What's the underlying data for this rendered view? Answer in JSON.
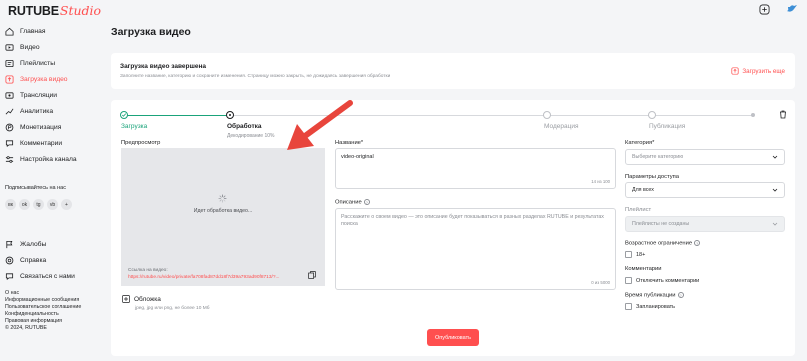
{
  "app": {
    "brand": "RUTUBE",
    "brand_suffix": "Studio",
    "accent": "#ff4f4f"
  },
  "sidebar": {
    "items": [
      {
        "label": "Главная",
        "icon": "home-icon"
      },
      {
        "label": "Видео",
        "icon": "video-icon"
      },
      {
        "label": "Плейлисты",
        "icon": "playlist-icon"
      },
      {
        "label": "Загрузка видео",
        "icon": "upload-icon",
        "active": true
      },
      {
        "label": "Трансляции",
        "icon": "broadcast-icon"
      },
      {
        "label": "Аналитика",
        "icon": "analytics-icon"
      },
      {
        "label": "Монетизация",
        "icon": "monetization-icon"
      },
      {
        "label": "Комментарии",
        "icon": "comments-icon"
      },
      {
        "label": "Настройка канала",
        "icon": "settings-icon"
      }
    ],
    "subscribe_label": "Подписывайтесь на нас",
    "socials": [
      "вк",
      "ok",
      "tg",
      "vb",
      "+"
    ],
    "bottom_items": [
      {
        "label": "Жалобы",
        "icon": "flag-icon"
      },
      {
        "label": "Справка",
        "icon": "help-icon"
      },
      {
        "label": "Связаться с нами",
        "icon": "contact-icon"
      }
    ],
    "footer_links": [
      "О нас",
      "Информационные сообщения",
      "Пользовательское соглашение",
      "Конфиденциальность",
      "Правовая информация",
      "© 2024, RUTUBE"
    ]
  },
  "header": {
    "title": "Загрузка видео"
  },
  "banner": {
    "title": "Загрузка видео завершена",
    "description": "Заполните название, категорию и сохраните изменения. Страницу можно закрыть, не дожидаясь завершения обработки",
    "upload_more": "Загрузить еще"
  },
  "steps": [
    {
      "label": "Загрузка",
      "state": "done"
    },
    {
      "label": "Обработка",
      "sub": "Декодирование 10%",
      "state": "active"
    },
    {
      "label": "Модерация",
      "state": "pending"
    },
    {
      "label": "Публикация",
      "state": "pending"
    }
  ],
  "preview": {
    "label": "Предпросмотр",
    "processing": "Идет обработка видео...",
    "link_label": "Ссылка на видео:",
    "link": "https://rutube.ru/video/private/fa708fad87dd18f7d39a793ad90f8713/?..."
  },
  "cover": {
    "label": "Обложка",
    "hint": "jpeg, jpg или png, не более 10 Мб"
  },
  "form": {
    "name_label": "Название*",
    "name_value": "video-original",
    "name_count": "14 из 100",
    "desc_label": "Описание",
    "desc_placeholder": "Расскажите о своем видео — это описание будет показываться в разных разделах RUTUBE и результатах поиска",
    "desc_count": "0 из 5000"
  },
  "right": {
    "category_label": "Категория*",
    "category_placeholder": "Выберите категорию",
    "access_label": "Параметры доступа",
    "access_value": "Для всех",
    "playlist_label": "Плейлист",
    "playlist_placeholder": "Плейлисты не созданы",
    "age_label": "Возрастное ограничение",
    "age_value": "18+",
    "comments_label": "Комментарии",
    "comments_value": "Отключить комментарии",
    "pubtime_label": "Время публикации",
    "pubtime_value": "Запланировать"
  },
  "actions": {
    "publish": "Опубликовать"
  }
}
